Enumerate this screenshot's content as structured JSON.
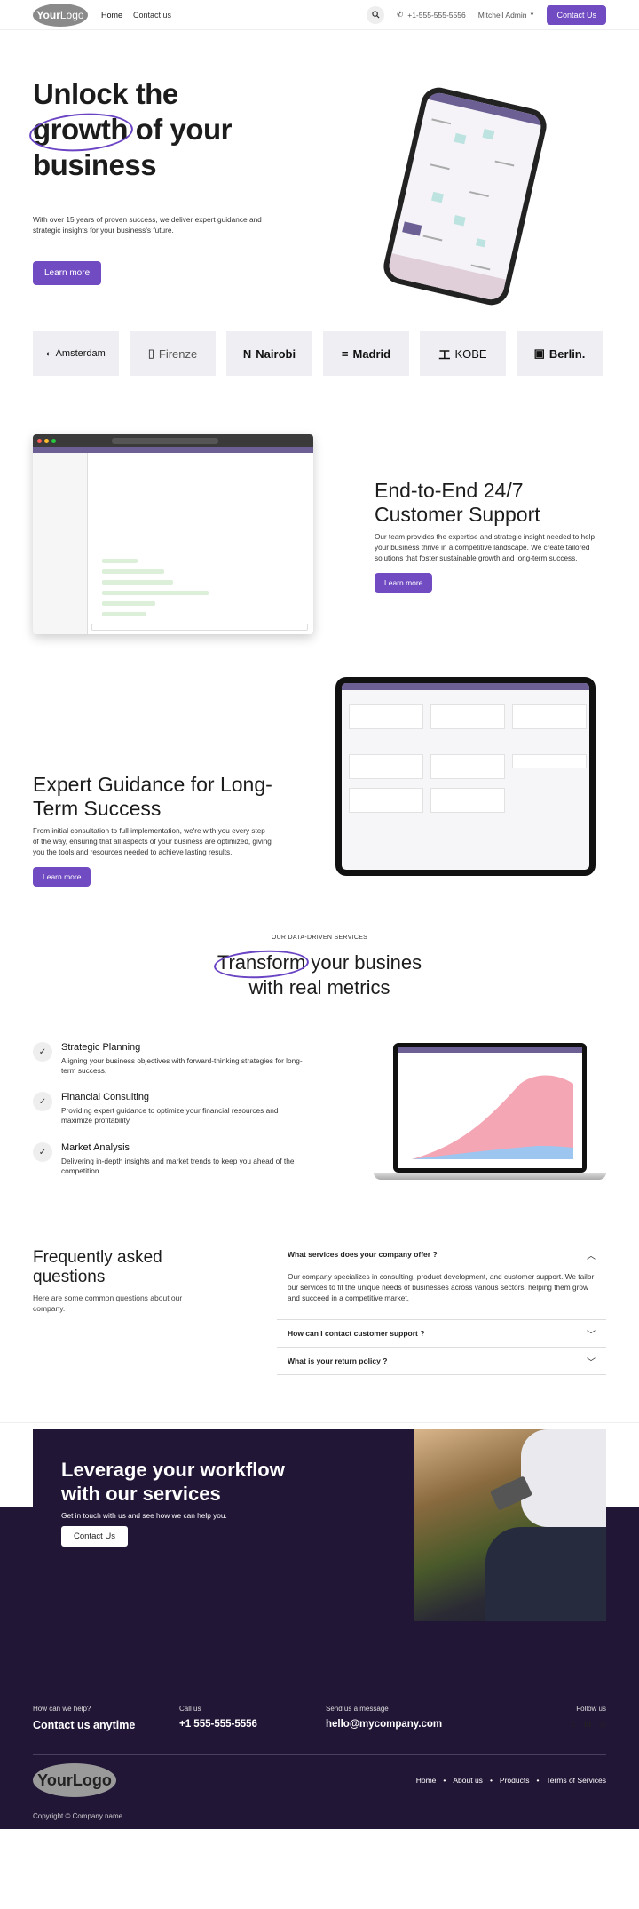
{
  "header": {
    "logo_bold": "Your",
    "logo_light": "Logo",
    "nav": [
      "Home",
      "Contact us"
    ],
    "phone": "+1-555-555-5556",
    "user": "Mitchell Admin",
    "cta": "Contact Us"
  },
  "hero": {
    "title_1": "Unlock the",
    "title_circled": "growth",
    "title_2": " of your business",
    "text": "With over 15 years of proven success, we deliver expert guidance and strategic insights for your business's future.",
    "button": "Learn more"
  },
  "logos": [
    "Amsterdam",
    "Firenze",
    "Nairobi",
    "Madrid",
    "KOBE",
    "Berlin."
  ],
  "support": {
    "title": "End-to-End 24/7 Customer Support",
    "text": "Our team provides the expertise and strategic insight needed to help your business thrive in a competitive landscape. We create tailored solutions that foster sustainable growth and long-term success.",
    "button": "Learn more"
  },
  "guidance": {
    "title": "Expert Guidance for Long-Term Success",
    "text": "From initial consultation to full implementation, we're with you every step of the way, ensuring that all aspects of your business are optimized, giving you the tools and resources needed to achieve lasting results.",
    "button": "Learn more"
  },
  "metrics": {
    "eyebrow": "OUR DATA-DRIVEN SERVICES",
    "title_circled": "Transform",
    "title_rest": " your busines",
    "title_2": "with real metrics",
    "items": [
      {
        "title": "Strategic Planning",
        "text": "Aligning your business objectives with forward-thinking strategies for long-term success."
      },
      {
        "title": "Financial Consulting",
        "text": "Providing expert guidance to optimize your financial resources and maximize profitability."
      },
      {
        "title": "Market Analysis",
        "text": "Delivering in-depth insights and market trends to keep you ahead of the competition."
      }
    ]
  },
  "faq": {
    "title": "Frequently asked questions",
    "subtitle": "Here are some common questions about our company.",
    "items": [
      {
        "q": "What services does your company offer ?",
        "a": "Our company specializes in consulting, product development, and customer support. We tailor our services to fit the unique needs of businesses across various sectors, helping them grow and succeed in a competitive market."
      },
      {
        "q": "How can I contact customer support ?"
      },
      {
        "q": "What is your return policy ?"
      }
    ]
  },
  "cta": {
    "title": "Leverage your workflow with our services",
    "text": "Get in touch with us and see how we can help you.",
    "button": "Contact Us"
  },
  "footer": {
    "help_small": "How can we help?",
    "help_big": "Contact us anytime",
    "call_small": "Call us",
    "call_big": "+1 555-555-5556",
    "msg_small": "Send us a message",
    "msg_big": "hello@mycompany.com",
    "follow": "Follow us",
    "logo": "YourLogo",
    "nav": [
      "Home",
      "About us",
      "Products",
      "Terms of Services"
    ],
    "copyright": "Copyright © Company name"
  },
  "colors": {
    "accent": "#714bc2",
    "dark": "#221637"
  }
}
